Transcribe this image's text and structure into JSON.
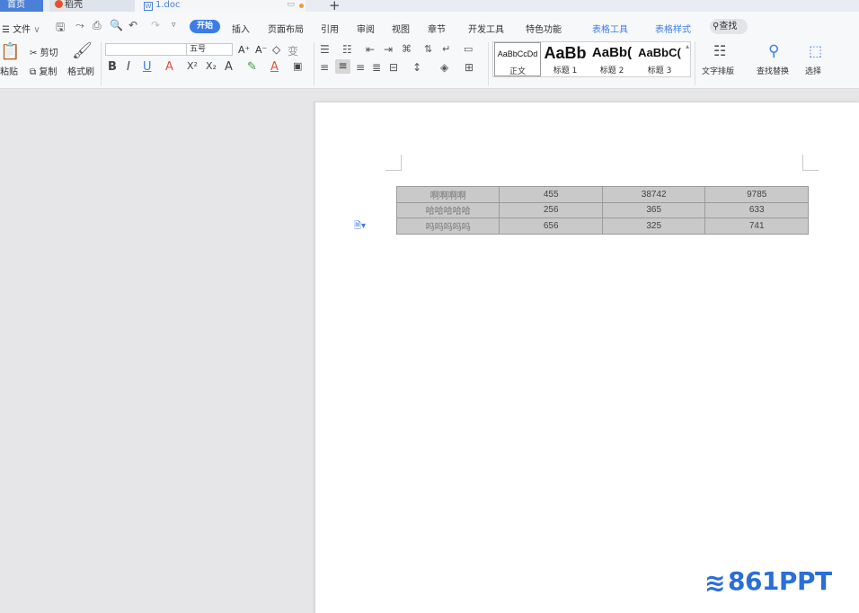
{
  "tabs": {
    "home": "首页",
    "daoke": "稻壳",
    "doc": "1.doc",
    "doc_icon": "W",
    "new": "+"
  },
  "menu": {
    "file": "☰ 文件",
    "file_caret": "∨",
    "start": "开始",
    "items": [
      "插入",
      "页面布局",
      "引用",
      "审阅",
      "视图",
      "章节",
      "开发工具",
      "特色功能"
    ],
    "context_items": [
      "表格工具",
      "表格样式"
    ],
    "search": "查找"
  },
  "clipboard": {
    "paste": "粘贴",
    "cut": "剪切",
    "copy": "复制",
    "format_painter": "格式刷"
  },
  "font": {
    "name": "",
    "size": "五号",
    "grow": "A⁺",
    "shrink": "A⁻"
  },
  "styles": [
    {
      "sample": "AaBbCcDd",
      "name": "正文"
    },
    {
      "sample": "AaBb",
      "name": "标题 1"
    },
    {
      "sample": "AaBb(",
      "name": "标题 2"
    },
    {
      "sample": "AaBbC(",
      "name": "标题 3"
    }
  ],
  "right_tools": {
    "text_layout": "文字排版",
    "find_replace": "查找替换",
    "select": "选择"
  },
  "table": {
    "rows": [
      [
        "啊啊啊啊",
        "455",
        "38742",
        "9785"
      ],
      [
        "哈哈哈哈哈",
        "256",
        "365",
        "633"
      ],
      [
        "吗吗吗吗吗",
        "656",
        "325",
        "741"
      ]
    ]
  },
  "watermark": "861PPT",
  "accent_color": "#3c7de6"
}
